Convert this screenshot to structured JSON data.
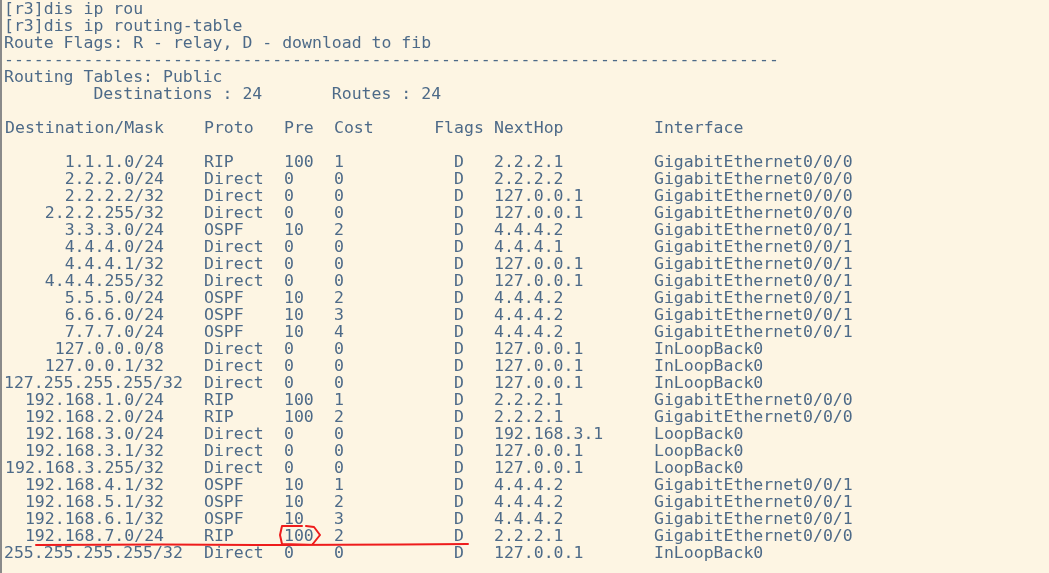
{
  "terminal": {
    "lines_before": [
      "[r3]dis ip rou",
      "[r3]dis ip routing-table",
      "Route Flags: R - relay, D - download to fib",
      "------------------------------------------------------------------------------",
      "Routing Tables: Public",
      "         Destinations : 24       Routes : 24"
    ],
    "columns": [
      "Destination/Mask",
      "Proto",
      "Pre",
      "Cost",
      "Flags",
      "NextHop",
      "Interface"
    ],
    "rows": [
      [
        "1.1.1.0/24",
        "RIP",
        "100",
        "1",
        "D",
        "2.2.2.1",
        "GigabitEthernet0/0/0"
      ],
      [
        "2.2.2.0/24",
        "Direct",
        "0",
        "0",
        "D",
        "2.2.2.2",
        "GigabitEthernet0/0/0"
      ],
      [
        "2.2.2.2/32",
        "Direct",
        "0",
        "0",
        "D",
        "127.0.0.1",
        "GigabitEthernet0/0/0"
      ],
      [
        "2.2.2.255/32",
        "Direct",
        "0",
        "0",
        "D",
        "127.0.0.1",
        "GigabitEthernet0/0/0"
      ],
      [
        "3.3.3.0/24",
        "OSPF",
        "10",
        "2",
        "D",
        "4.4.4.2",
        "GigabitEthernet0/0/1"
      ],
      [
        "4.4.4.0/24",
        "Direct",
        "0",
        "0",
        "D",
        "4.4.4.1",
        "GigabitEthernet0/0/1"
      ],
      [
        "4.4.4.1/32",
        "Direct",
        "0",
        "0",
        "D",
        "127.0.0.1",
        "GigabitEthernet0/0/1"
      ],
      [
        "4.4.4.255/32",
        "Direct",
        "0",
        "0",
        "D",
        "127.0.0.1",
        "GigabitEthernet0/0/1"
      ],
      [
        "5.5.5.0/24",
        "OSPF",
        "10",
        "2",
        "D",
        "4.4.4.2",
        "GigabitEthernet0/0/1"
      ],
      [
        "6.6.6.0/24",
        "OSPF",
        "10",
        "3",
        "D",
        "4.4.4.2",
        "GigabitEthernet0/0/1"
      ],
      [
        "7.7.7.0/24",
        "OSPF",
        "10",
        "4",
        "D",
        "4.4.4.2",
        "GigabitEthernet0/0/1"
      ],
      [
        "127.0.0.0/8",
        "Direct",
        "0",
        "0",
        "D",
        "127.0.0.1",
        "InLoopBack0"
      ],
      [
        "127.0.0.1/32",
        "Direct",
        "0",
        "0",
        "D",
        "127.0.0.1",
        "InLoopBack0"
      ],
      [
        "127.255.255.255/32",
        "Direct",
        "0",
        "0",
        "D",
        "127.0.0.1",
        "InLoopBack0"
      ],
      [
        "192.168.1.0/24",
        "RIP",
        "100",
        "1",
        "D",
        "2.2.2.1",
        "GigabitEthernet0/0/0"
      ],
      [
        "192.168.2.0/24",
        "RIP",
        "100",
        "2",
        "D",
        "2.2.2.1",
        "GigabitEthernet0/0/0"
      ],
      [
        "192.168.3.0/24",
        "Direct",
        "0",
        "0",
        "D",
        "192.168.3.1",
        "LoopBack0"
      ],
      [
        "192.168.3.1/32",
        "Direct",
        "0",
        "0",
        "D",
        "127.0.0.1",
        "LoopBack0"
      ],
      [
        "192.168.3.255/32",
        "Direct",
        "0",
        "0",
        "D",
        "127.0.0.1",
        "LoopBack0"
      ],
      [
        "192.168.4.1/32",
        "OSPF",
        "10",
        "1",
        "D",
        "4.4.4.2",
        "GigabitEthernet0/0/1"
      ],
      [
        "192.168.5.1/32",
        "OSPF",
        "10",
        "2",
        "D",
        "4.4.4.2",
        "GigabitEthernet0/0/1"
      ],
      [
        "192.168.6.1/32",
        "OSPF",
        "10",
        "3",
        "D",
        "4.4.4.2",
        "GigabitEthernet0/0/1"
      ],
      [
        "192.168.7.0/24",
        "RIP",
        "100",
        "2",
        "D",
        "2.2.2.1",
        "GigabitEthernet0/0/0"
      ],
      [
        "255.255.255.255/32",
        "Direct",
        "0",
        "0",
        "D",
        "127.0.0.1",
        "InLoopBack0"
      ]
    ]
  }
}
